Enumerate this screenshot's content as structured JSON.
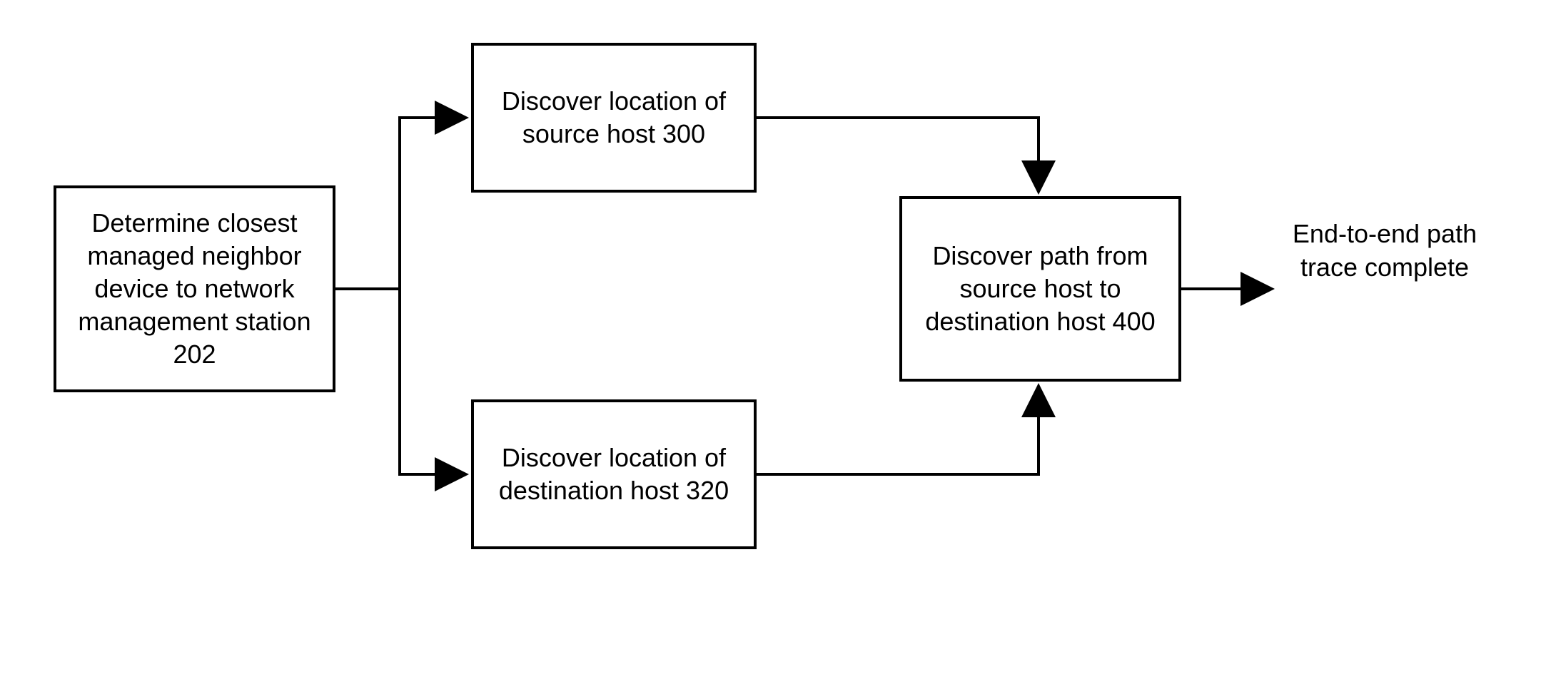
{
  "boxes": {
    "determine": {
      "text": "Determine closest managed neighbor device to network management station 202"
    },
    "source": {
      "text": "Discover location of source host 300"
    },
    "dest": {
      "text": "Discover location of destination host 320"
    },
    "path": {
      "text": "Discover path from source host to destination host 400"
    }
  },
  "endLabel": "End-to-end path trace complete"
}
